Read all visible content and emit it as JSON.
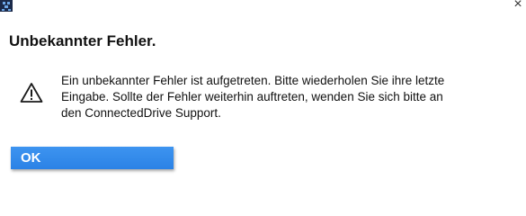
{
  "window": {
    "app_icon": "connecteddrive-app-icon",
    "close_glyph": "×"
  },
  "dialog": {
    "title": "Unbekannter Fehler.",
    "icon": "warning-icon",
    "message_lines": [
      "Ein unbekannter Fehler ist aufgetreten. Bitte wiederholen Sie ihre letzte",
      "Eingabe. Sollte der Fehler weiterhin auftreten, wenden Sie sich bitte an",
      "den ConnectedDrive Support."
    ],
    "ok_label": "OK"
  },
  "colors": {
    "button_blue": "#2f87ea",
    "text": "#111111"
  }
}
